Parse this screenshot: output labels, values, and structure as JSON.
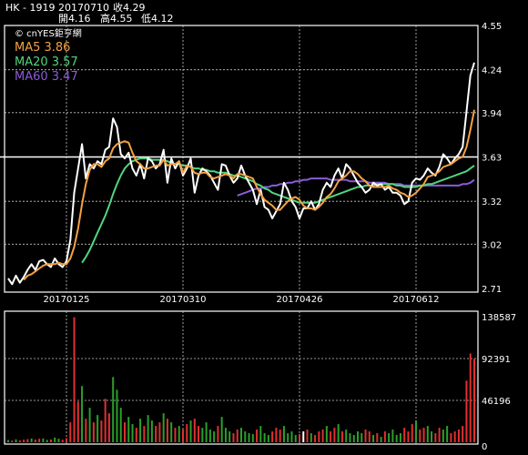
{
  "header": {
    "symbol": "HK - 1919",
    "date": "20170710",
    "close_label": "收4.29",
    "open_label": "開4.16",
    "high_label": "高4.55",
    "low_label": "低4.12"
  },
  "copyright": "© cnYES鉅亨網",
  "colors": {
    "background": "#000000",
    "price": "#ffffff",
    "ma5": "#f5a142",
    "ma20": "#4fd67f",
    "ma60": "#8c5bd9",
    "grid": "#c8c8c8",
    "vol_up": "#e03030",
    "vol_down": "#2aa02a",
    "vol_flat": "#ffffff"
  },
  "chart_data": [
    {
      "type": "line",
      "title": "",
      "legend": [
        {
          "label": "MA5 3.86",
          "color_key": "ma5"
        },
        {
          "label": "MA20 3.57",
          "color_key": "ma20"
        },
        {
          "label": "MA60 3.47",
          "color_key": "ma60"
        }
      ],
      "legend_position": "top-left",
      "y_ticks": [
        "4.55",
        "4.24",
        "3.94",
        "3.63",
        "3.32",
        "3.02",
        "2.71"
      ],
      "y_tick_values": [
        4.55,
        4.24,
        3.94,
        3.63,
        3.32,
        3.02,
        2.71
      ],
      "ylim": [
        2.71,
        4.55
      ],
      "highlight_y": 3.63,
      "x_ticks": [
        {
          "label": "20170125",
          "index": 15
        },
        {
          "label": "20170310",
          "index": 45
        },
        {
          "label": "20170426",
          "index": 75
        },
        {
          "label": "20170612",
          "index": 105
        }
      ],
      "n_points": 121,
      "grid": true,
      "series": [
        {
          "key": "price",
          "values": [
            2.78,
            2.74,
            2.8,
            2.75,
            2.79,
            2.84,
            2.88,
            2.84,
            2.9,
            2.91,
            2.88,
            2.86,
            2.92,
            2.88,
            2.86,
            2.9,
            3.05,
            3.38,
            3.55,
            3.72,
            3.48,
            3.58,
            3.55,
            3.6,
            3.58,
            3.68,
            3.7,
            3.9,
            3.84,
            3.65,
            3.62,
            3.66,
            3.55,
            3.5,
            3.58,
            3.48,
            3.62,
            3.6,
            3.55,
            3.58,
            3.68,
            3.45,
            3.62,
            3.55,
            3.6,
            3.5,
            3.55,
            3.62,
            3.38,
            3.5,
            3.55,
            3.53,
            3.5,
            3.45,
            3.4,
            3.58,
            3.57,
            3.5,
            3.45,
            3.48,
            3.57,
            3.5,
            3.45,
            3.4,
            3.3,
            3.4,
            3.28,
            3.26,
            3.2,
            3.25,
            3.3,
            3.45,
            3.4,
            3.32,
            3.28,
            3.2,
            3.27,
            3.27,
            3.32,
            3.26,
            3.3,
            3.4,
            3.45,
            3.42,
            3.5,
            3.55,
            3.48,
            3.58,
            3.55,
            3.5,
            3.45,
            3.42,
            3.38,
            3.4,
            3.45,
            3.43,
            3.44,
            3.4,
            3.42,
            3.38,
            3.38,
            3.36,
            3.3,
            3.32,
            3.45,
            3.48,
            3.47,
            3.5,
            3.55,
            3.52,
            3.5,
            3.56,
            3.65,
            3.62,
            3.58,
            3.62,
            3.65,
            3.7,
            3.95,
            4.2,
            4.29
          ]
        },
        {
          "key": "ma5",
          "values": [
            null,
            null,
            null,
            null,
            2.77,
            2.8,
            2.81,
            2.83,
            2.85,
            2.87,
            2.88,
            2.88,
            2.88,
            2.89,
            2.88,
            2.88,
            2.92,
            3.0,
            3.13,
            3.3,
            3.44,
            3.54,
            3.58,
            3.58,
            3.56,
            3.6,
            3.62,
            3.69,
            3.72,
            3.73,
            3.74,
            3.73,
            3.66,
            3.6,
            3.58,
            3.55,
            3.55,
            3.56,
            3.57,
            3.57,
            3.61,
            3.57,
            3.58,
            3.58,
            3.6,
            3.52,
            3.57,
            3.56,
            3.52,
            3.51,
            3.52,
            3.52,
            3.49,
            3.48,
            3.49,
            3.5,
            3.51,
            3.5,
            3.48,
            3.51,
            3.51,
            3.5,
            3.49,
            3.48,
            3.42,
            3.37,
            3.33,
            3.31,
            3.29,
            3.26,
            3.26,
            3.29,
            3.32,
            3.34,
            3.35,
            3.33,
            3.29,
            3.27,
            3.27,
            3.26,
            3.28,
            3.31,
            3.35,
            3.37,
            3.41,
            3.46,
            3.48,
            3.5,
            3.53,
            3.53,
            3.51,
            3.48,
            3.46,
            3.43,
            3.42,
            3.42,
            3.42,
            3.42,
            3.43,
            3.41,
            3.4,
            3.38,
            3.37,
            3.35,
            3.36,
            3.38,
            3.41,
            3.44,
            3.49,
            3.5,
            3.51,
            3.53,
            3.56,
            3.57,
            3.58,
            3.6,
            3.62,
            3.63,
            3.7,
            3.82,
            3.96
          ]
        },
        {
          "key": "ma20",
          "values": [
            null,
            null,
            null,
            null,
            null,
            null,
            null,
            null,
            null,
            null,
            null,
            null,
            null,
            null,
            null,
            null,
            null,
            null,
            null,
            2.89,
            2.93,
            2.98,
            3.04,
            3.1,
            3.16,
            3.22,
            3.29,
            3.37,
            3.44,
            3.5,
            3.55,
            3.58,
            3.6,
            3.61,
            3.62,
            3.62,
            3.62,
            3.61,
            3.61,
            3.61,
            3.61,
            3.6,
            3.59,
            3.58,
            3.58,
            3.57,
            3.57,
            3.56,
            3.55,
            3.55,
            3.54,
            3.54,
            3.53,
            3.53,
            3.52,
            3.52,
            3.52,
            3.51,
            3.5,
            3.5,
            3.49,
            3.48,
            3.47,
            3.46,
            3.44,
            3.43,
            3.41,
            3.4,
            3.38,
            3.37,
            3.36,
            3.35,
            3.34,
            3.33,
            3.32,
            3.31,
            3.31,
            3.31,
            3.31,
            3.31,
            3.32,
            3.33,
            3.34,
            3.35,
            3.36,
            3.37,
            3.38,
            3.39,
            3.4,
            3.41,
            3.42,
            3.42,
            3.43,
            3.43,
            3.43,
            3.44,
            3.44,
            3.44,
            3.44,
            3.44,
            3.43,
            3.43,
            3.42,
            3.42,
            3.42,
            3.42,
            3.43,
            3.43,
            3.44,
            3.44,
            3.45,
            3.46,
            3.47,
            3.48,
            3.49,
            3.5,
            3.51,
            3.52,
            3.53,
            3.55,
            3.57
          ]
        },
        {
          "key": "ma60",
          "values": [
            null,
            null,
            null,
            null,
            null,
            null,
            null,
            null,
            null,
            null,
            null,
            null,
            null,
            null,
            null,
            null,
            null,
            null,
            null,
            null,
            null,
            null,
            null,
            null,
            null,
            null,
            null,
            null,
            null,
            null,
            null,
            null,
            null,
            null,
            null,
            null,
            null,
            null,
            null,
            null,
            null,
            null,
            null,
            null,
            null,
            null,
            null,
            null,
            null,
            null,
            null,
            null,
            null,
            null,
            null,
            null,
            null,
            null,
            null,
            3.36,
            3.37,
            3.38,
            3.39,
            3.4,
            3.41,
            3.41,
            3.42,
            3.42,
            3.43,
            3.43,
            3.44,
            3.44,
            3.45,
            3.45,
            3.46,
            3.46,
            3.47,
            3.47,
            3.48,
            3.48,
            3.48,
            3.48,
            3.48,
            3.47,
            3.47,
            3.47,
            3.47,
            3.47,
            3.46,
            3.46,
            3.46,
            3.46,
            3.46,
            3.45,
            3.45,
            3.45,
            3.45,
            3.45,
            3.44,
            3.44,
            3.44,
            3.44,
            3.43,
            3.43,
            3.43,
            3.43,
            3.43,
            3.43,
            3.43,
            3.43,
            3.43,
            3.43,
            3.43,
            3.43,
            3.43,
            3.43,
            3.43,
            3.44,
            3.44,
            3.45,
            3.47
          ]
        }
      ]
    },
    {
      "type": "bar",
      "title": "",
      "y_ticks": [
        "138587",
        "92391",
        "46196",
        "0"
      ],
      "y_tick_values": [
        138587,
        92391,
        46196,
        0
      ],
      "ylim": [
        0,
        138587
      ],
      "grid": true,
      "volumes": [
        2500,
        1800,
        3200,
        2100,
        2800,
        3500,
        4100,
        3000,
        3800,
        4200,
        2600,
        3100,
        5200,
        3900,
        2800,
        4500,
        22000,
        138000,
        45000,
        62000,
        26000,
        38000,
        22000,
        30000,
        24000,
        48000,
        32000,
        72000,
        58000,
        38000,
        22000,
        28000,
        20000,
        16000,
        26000,
        18000,
        30000,
        24000,
        18000,
        22000,
        32000,
        26000,
        22000,
        16000,
        18000,
        14000,
        20000,
        24000,
        26000,
        18000,
        16000,
        22000,
        14000,
        12000,
        18000,
        28000,
        16000,
        12000,
        10000,
        14000,
        16000,
        12000,
        10000,
        9000,
        14000,
        18000,
        10000,
        8000,
        12000,
        16000,
        14000,
        18000,
        10000,
        12000,
        8000,
        9000,
        12000,
        14000,
        10000,
        8000,
        12000,
        14000,
        18000,
        12000,
        16000,
        20000,
        12000,
        14000,
        10000,
        8000,
        12000,
        10000,
        14000,
        12000,
        8000,
        10000,
        6000,
        12000,
        10000,
        14000,
        8000,
        10000,
        16000,
        12000,
        20000,
        24000,
        14000,
        16000,
        18000,
        12000,
        10000,
        16000,
        14000,
        18000,
        10000,
        12000,
        14000,
        18000,
        68000,
        98000,
        92000
      ],
      "directions": [
        "d",
        "u",
        "d",
        "u",
        "u",
        "u",
        "d",
        "u",
        "u",
        "d",
        "d",
        "u",
        "d",
        "d",
        "u",
        "u",
        "u",
        "u",
        "u",
        "d",
        "u",
        "d",
        "u",
        "d",
        "u",
        "u",
        "u",
        "d",
        "d",
        "d",
        "u",
        "d",
        "d",
        "u",
        "d",
        "u",
        "d",
        "d",
        "u",
        "u",
        "d",
        "u",
        "d",
        "u",
        "d",
        "u",
        "u",
        "d",
        "u",
        "u",
        "d",
        "d",
        "d",
        "d",
        "u",
        "d",
        "d",
        "d",
        "u",
        "u",
        "d",
        "d",
        "d",
        "d",
        "u",
        "d",
        "d",
        "d",
        "u",
        "u",
        "u",
        "d",
        "d",
        "d",
        "d",
        "u",
        "f",
        "u",
        "d",
        "u",
        "u",
        "u",
        "d",
        "u",
        "u",
        "d",
        "u",
        "d",
        "d",
        "d",
        "d",
        "d",
        "u",
        "u",
        "d",
        "u",
        "d",
        "u",
        "d",
        "d",
        "d",
        "d",
        "u",
        "u",
        "u",
        "d",
        "u",
        "u",
        "d",
        "d",
        "u",
        "u",
        "d",
        "d",
        "u",
        "u",
        "u",
        "u",
        "u",
        "u",
        "u"
      ]
    }
  ]
}
